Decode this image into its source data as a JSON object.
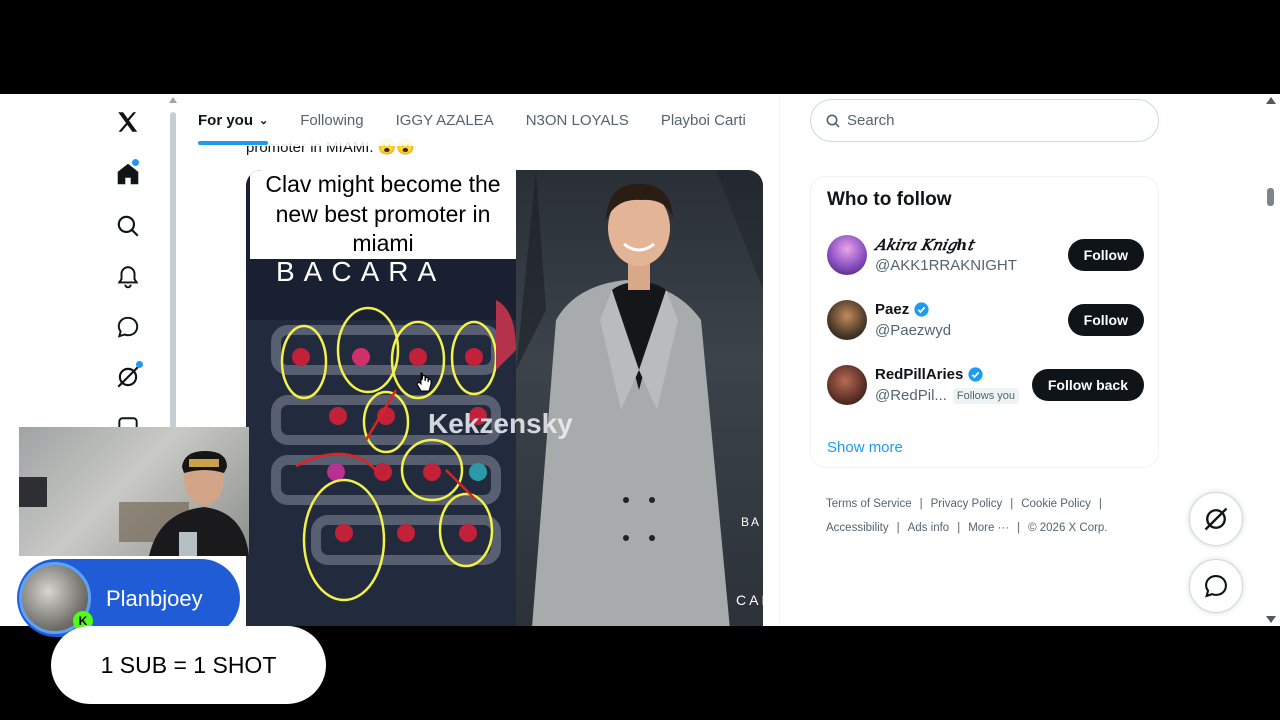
{
  "tabs": [
    {
      "label": "For you",
      "active": true
    },
    {
      "label": "Following"
    },
    {
      "label": "IGGY AZALEA"
    },
    {
      "label": "N3ON LOYALS"
    },
    {
      "label": "Playboi Carti"
    }
  ],
  "post": {
    "text_fragment": "promoter in MIAMI. 😮😮",
    "media_caption": "Clav might become the new best promoter in miami",
    "media_sign_left": "BACARA",
    "media_watermark": "Kekzensky",
    "media_sign_right": "CARA",
    "media_sign_right2": "BA"
  },
  "search": {
    "placeholder": "Search"
  },
  "who_to_follow": {
    "title": "Who to follow",
    "users": [
      {
        "name": "𝐴𝑘𝑖𝑟𝑎 𝐾𝑛𝑖𝑔ℎ𝑡",
        "handle": "@AKK1RRAKNIGHT",
        "verified": false,
        "follows_you": "",
        "button": "Follow",
        "avatar_color": "#8a4fc2"
      },
      {
        "name": "Paez",
        "handle": "@Paezwyd",
        "verified": true,
        "follows_you": "",
        "button": "Follow",
        "avatar_color": "#4a3a2a"
      },
      {
        "name": "RedPillAries",
        "handle": "@RedPil...",
        "verified": true,
        "follows_you": "Follows you",
        "button": "Follow back",
        "avatar_color": "#5a3026"
      }
    ],
    "show_more": "Show more"
  },
  "footer": {
    "line1": [
      "Terms of Service",
      "Privacy Policy",
      "Cookie Policy"
    ],
    "line2": [
      "Accessibility",
      "Ads info",
      "More ···"
    ],
    "copyright": "© 2026 X Corp."
  },
  "overlays": {
    "streamer_name": "Planbjoey",
    "kick_badge": "K",
    "banner": "1 SUB = 1 SHOT"
  },
  "colors": {
    "accent": "#1d9bf0",
    "streamer_pill": "#1f5cd6",
    "kick_green": "#53fc18"
  }
}
